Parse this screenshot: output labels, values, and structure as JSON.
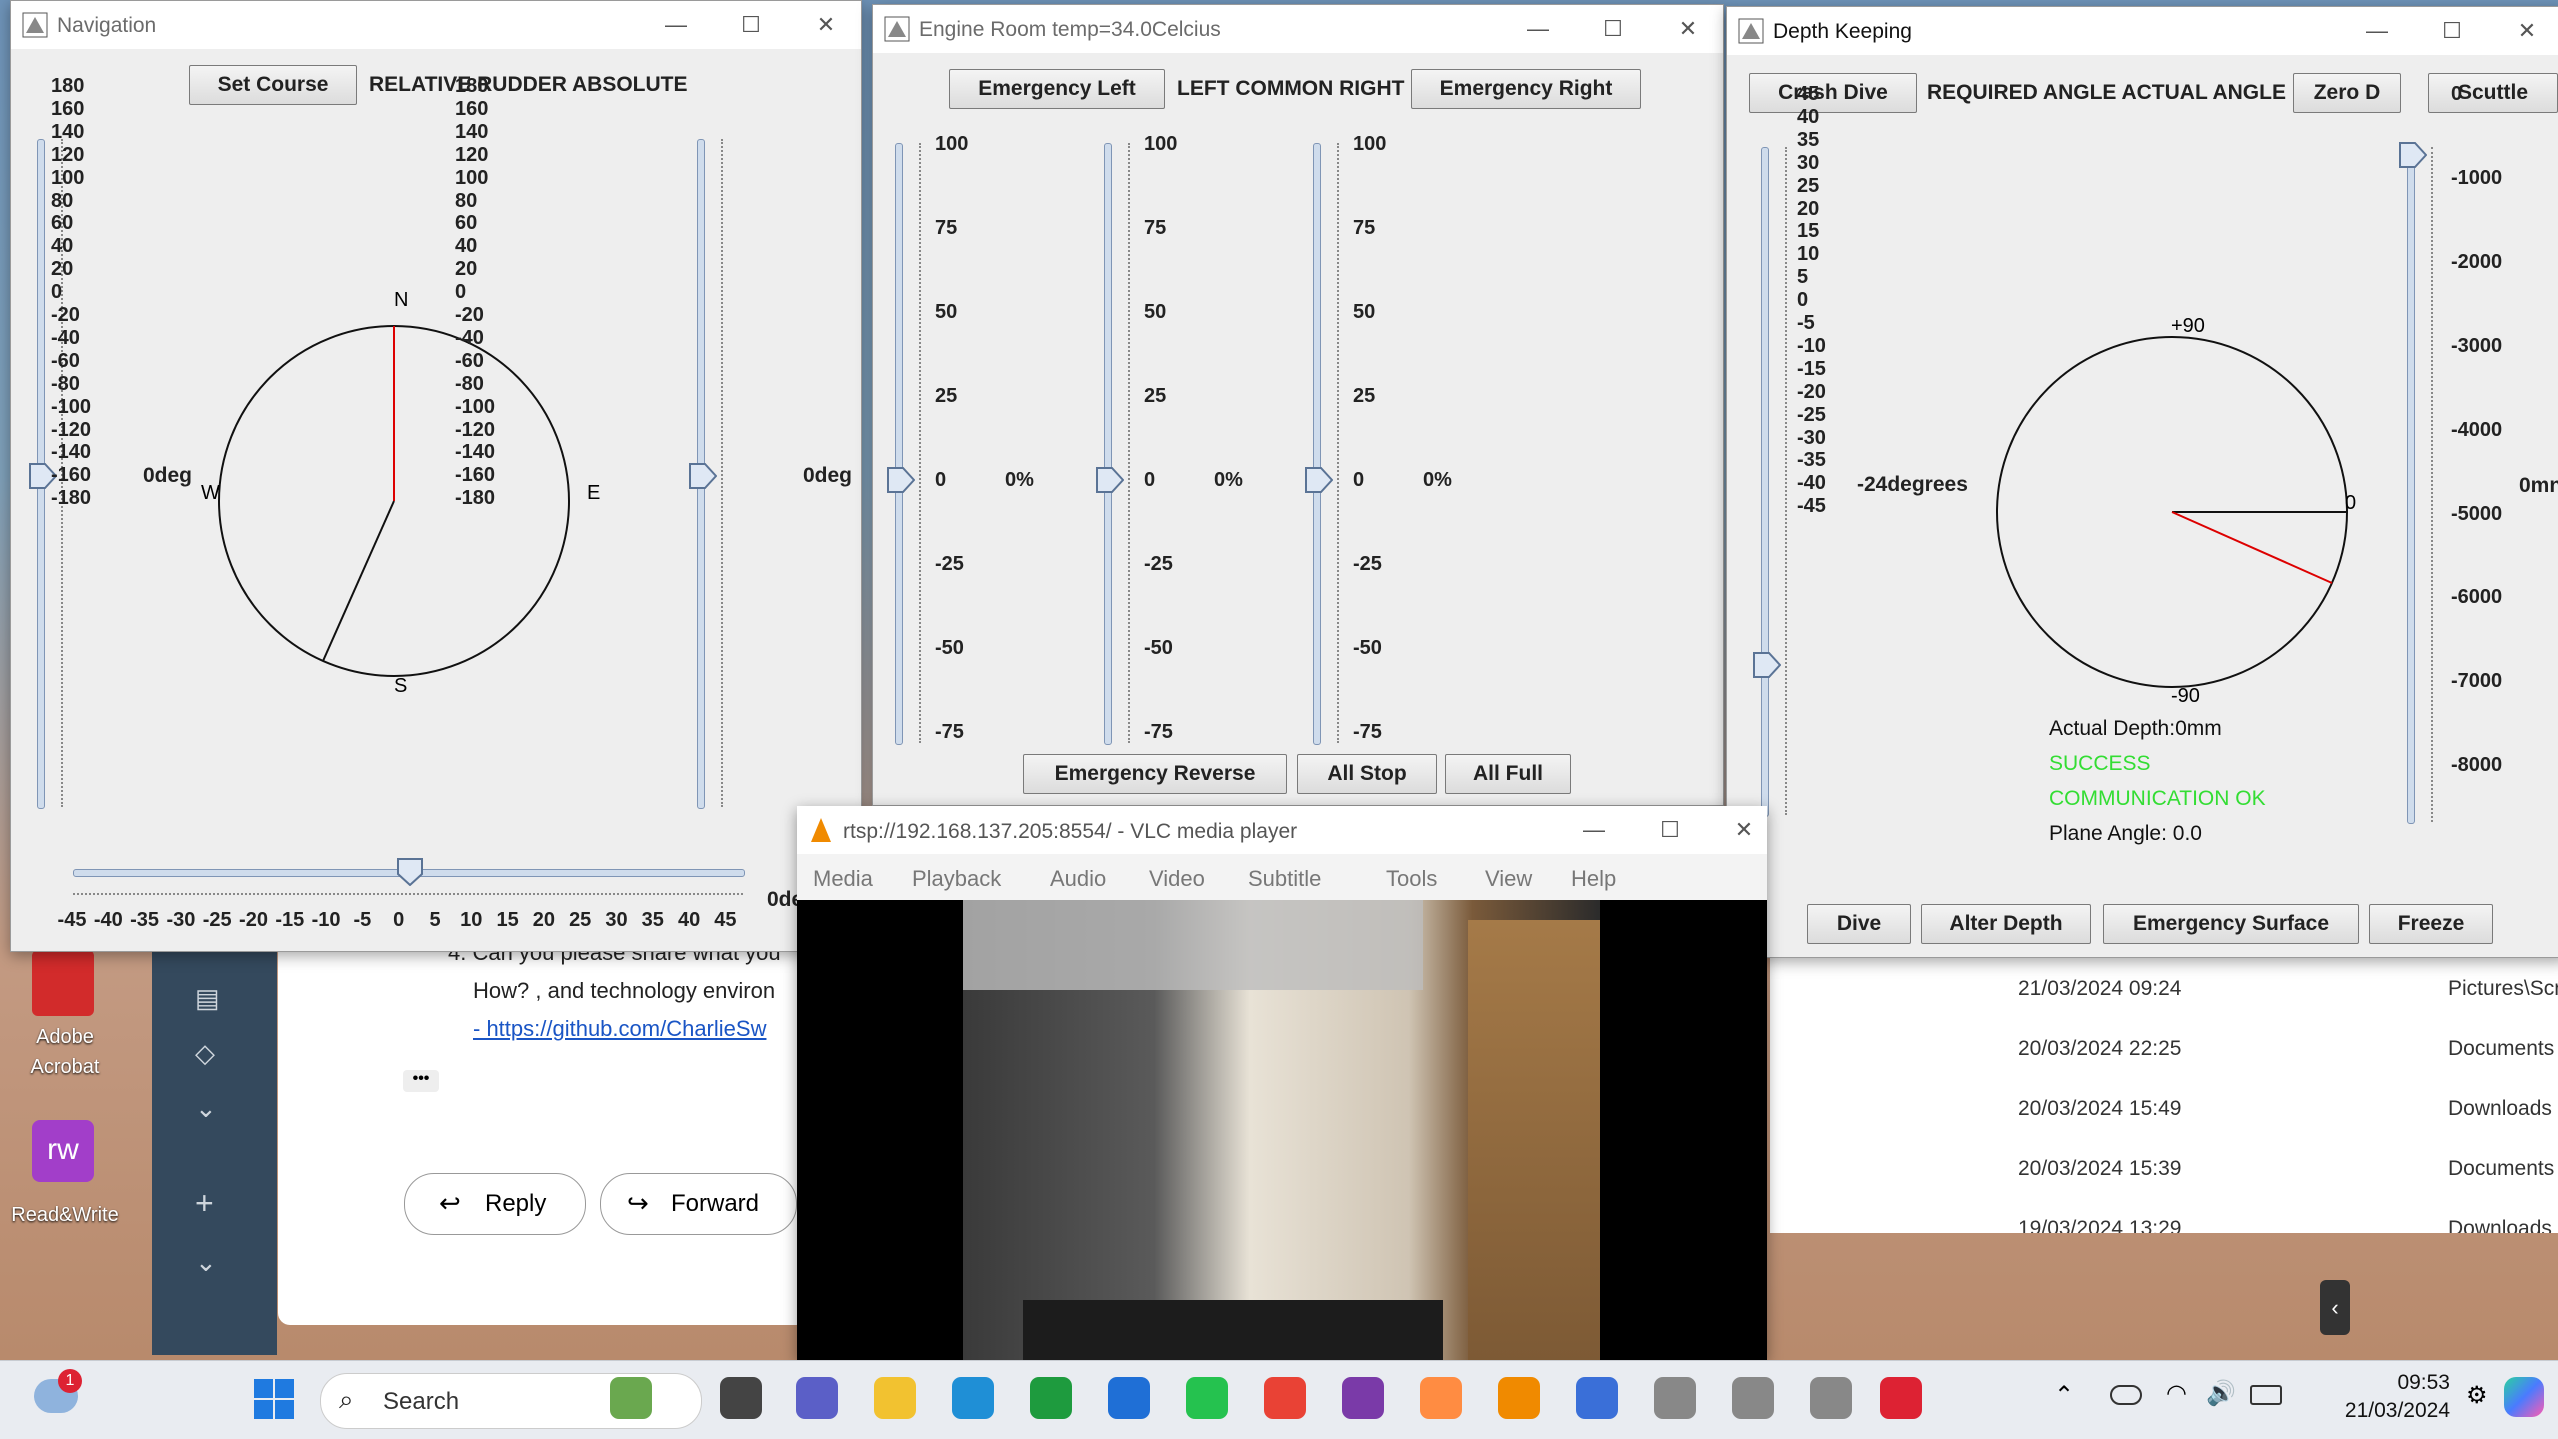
{
  "colors": {
    "accent": "#1f5fbf",
    "needle": "#d00000",
    "success": "#33dd33",
    "window_bg": "#eeeeee"
  },
  "navigation": {
    "title": "Navigation",
    "set_course": "Set Course",
    "mode_label": "RELATIVE RUDDER ABSOLUTE",
    "scale_ticks": [
      "180",
      "160",
      "140",
      "120",
      "100",
      "80",
      "60",
      "40",
      "20",
      "0",
      "-20",
      "-40",
      "-60",
      "-80",
      "-100",
      "-120",
      "-140",
      "-160",
      "-180"
    ],
    "left_value": "0deg",
    "right_value": "0deg",
    "compass": {
      "n": "N",
      "e": "E",
      "s": "S",
      "w": "W"
    },
    "rudder_ticks": [
      "-45",
      "-40",
      "-35",
      "-30",
      "-25",
      "-20",
      "-15",
      "-10",
      "-5",
      "0",
      "5",
      "10",
      "15",
      "20",
      "25",
      "30",
      "35",
      "40",
      "45"
    ],
    "rudder_value": "0de"
  },
  "engine": {
    "title": "Engine Room temp=34.0Celcius",
    "emergency_left": "Emergency Left",
    "header_label": "LEFT COMMON RIGHT",
    "emergency_right": "Emergency Right",
    "ticks": [
      "100",
      "75",
      "50",
      "25",
      "0",
      "-25",
      "-50",
      "-75"
    ],
    "percent": "0%",
    "emergency_reverse": "Emergency Reverse",
    "all_stop": "All Stop",
    "all_full": "All Full"
  },
  "depth": {
    "title": "Depth Keeping",
    "crash_dive": "Crash Dive",
    "header_label": "REQUIRED ANGLE ACTUAL ANGLE",
    "zero_d": "Zero D",
    "scuttle": "Scuttle",
    "angle_ticks": [
      "45",
      "40",
      "35",
      "30",
      "25",
      "20",
      "15",
      "10",
      "5",
      "0",
      "-5",
      "-10",
      "-15",
      "-20",
      "-25",
      "-30",
      "-35",
      "-40",
      "-45"
    ],
    "angle_value": "-24degrees",
    "depth_ticks": [
      "0",
      "-1000",
      "-2000",
      "-3000",
      "-4000",
      "-5000",
      "-6000",
      "-7000",
      "-8000"
    ],
    "depth_value": "0mn",
    "dial_top": "+90",
    "dial_bottom": "-90",
    "dial_right": "0",
    "actual_depth": "Actual Depth:0mm",
    "success": "SUCCESS",
    "comm": "COMMUNICATION OK",
    "plane_angle": "Plane Angle: 0.0",
    "dive": "Dive",
    "alter_depth": "Alter Depth",
    "emergency_surface": "Emergency Surface",
    "freeze": "Freeze"
  },
  "vlc": {
    "title": "rtsp://192.168.137.205:8554/ - VLC media player",
    "menu": [
      "Media",
      "Playback",
      "Audio",
      "Video",
      "Subtitle",
      "Tools",
      "View",
      "Help"
    ]
  },
  "email": {
    "line1": "4. Can you please share what you",
    "line2": "How? , and technology environ",
    "link": "- https://github.com/CharlieSw",
    "reply": "Reply",
    "forward": "Forward"
  },
  "files": {
    "rows": [
      {
        "date": "21/03/2024 09:24",
        "folder": "Pictures\\Scr"
      },
      {
        "date": "20/03/2024 22:25",
        "folder": "Documents"
      },
      {
        "date": "20/03/2024 15:49",
        "folder": "Downloads"
      },
      {
        "date": "20/03/2024 15:39",
        "folder": "Documents"
      },
      {
        "date": "19/03/2024 13:29",
        "folder": "Downloads"
      }
    ]
  },
  "desktop_icons": {
    "acrobat": "Adobe Acrobat",
    "readwrite": "Read&Write"
  },
  "taskbar": {
    "search": "Search",
    "time": "09:53",
    "date": "21/03/2024",
    "badge": "1"
  }
}
